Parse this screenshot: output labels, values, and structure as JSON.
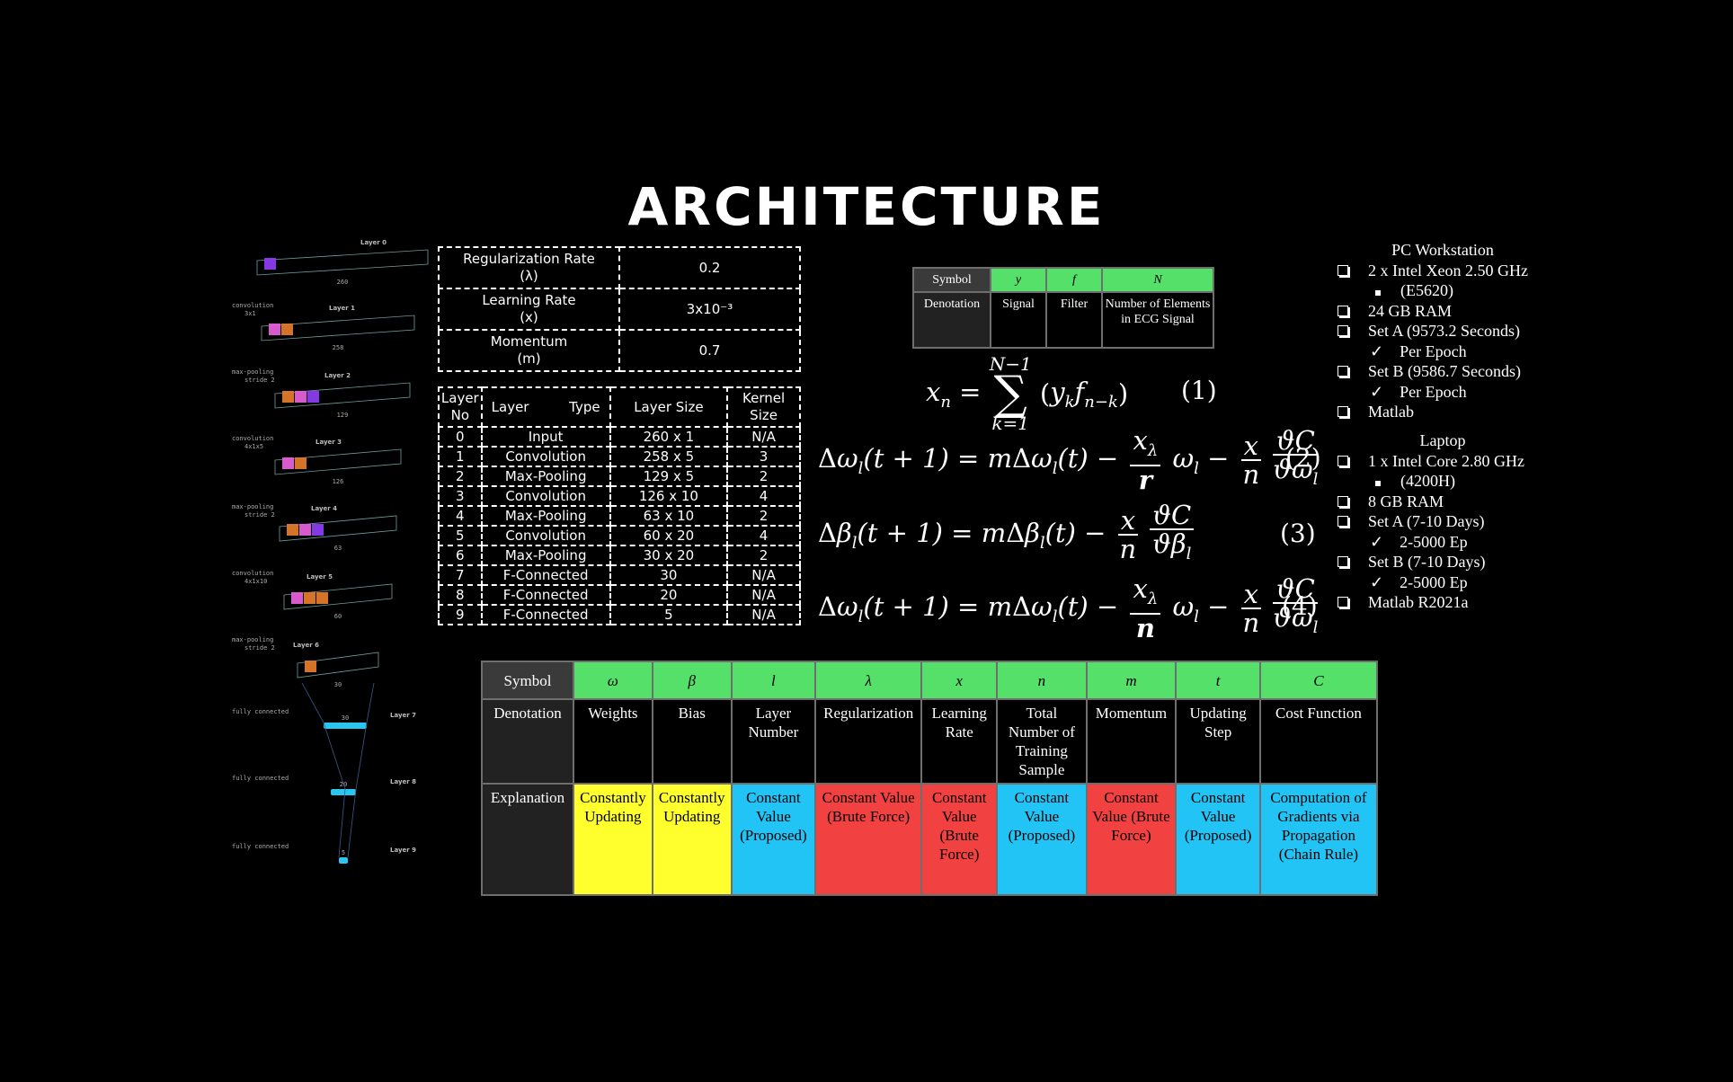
{
  "title": "ARCHITECTURE",
  "hyperparams": [
    {
      "name": "Regularization Rate",
      "symbol": "(λ)",
      "value": "0.2"
    },
    {
      "name": "Learning Rate",
      "symbol": "(x)",
      "value": "3x10⁻³"
    },
    {
      "name": "Momentum",
      "symbol": "(m)",
      "value": "0.7"
    }
  ],
  "layer_table": {
    "headers": {
      "layer_no": "Layer No",
      "layer": "Layer",
      "type": "Type",
      "size": "Layer Size",
      "kernel": "Kernel Size"
    },
    "rows": [
      [
        "0",
        "Input",
        "260 x 1",
        "N/A"
      ],
      [
        "1",
        "Convolution",
        "258 x 5",
        "3"
      ],
      [
        "2",
        "Max-Pooling",
        "129 x 5",
        "2"
      ],
      [
        "3",
        "Convolution",
        "126 x 10",
        "4"
      ],
      [
        "4",
        "Max-Pooling",
        "63 x 10",
        "2"
      ],
      [
        "5",
        "Convolution",
        "60 x 20",
        "4"
      ],
      [
        "6",
        "Max-Pooling",
        "30 x 20",
        "2"
      ],
      [
        "7",
        "F-Connected",
        "30",
        "N/A"
      ],
      [
        "8",
        "F-Connected",
        "20",
        "N/A"
      ],
      [
        "9",
        "F-Connected",
        "5",
        "N/A"
      ]
    ]
  },
  "signal_table": {
    "symbol_label": "Symbol",
    "denotation_label": "Denotation",
    "symbols": [
      "y",
      "f",
      "N"
    ],
    "denotations": [
      "Signal",
      "Filter",
      "Number of Elements in ECG Signal"
    ]
  },
  "equation_numbers": [
    "(1)",
    "(2)",
    "(3)",
    "(4)"
  ],
  "param_table": {
    "symbol_label": "Symbol",
    "denotation_label": "Denotation",
    "explanation_label": "Explanation",
    "symbols": [
      "ω",
      "β",
      "l",
      "λ",
      "x",
      "n",
      "m",
      "t",
      "C"
    ],
    "denotations": [
      "Weights",
      "Bias",
      "Layer Number",
      "Regularization",
      "Learning Rate",
      "Total Number of Training Sample",
      "Momentum",
      "Updating Step",
      "Cost Function"
    ],
    "explanations": [
      "Constantly Updating",
      "Constantly Updating",
      "Constant Value (Proposed)",
      "Constant Value (Brute Force)",
      "Constant Value (Brute Force)",
      "Constant Value (Proposed)",
      "Constant Value (Brute Force)",
      "Constant Value (Proposed)",
      "Computation of Gradients via Propagation (Chain Rule)"
    ],
    "colors": [
      "#ffff2e",
      "#ffff2e",
      "#22c4f5",
      "#f24141",
      "#f24141",
      "#22c4f5",
      "#f24141",
      "#22c4f5",
      "#22c4f5"
    ]
  },
  "pc": {
    "heading": "PC Workstation",
    "items": [
      {
        "kind": "box",
        "text": "2 x Intel Xeon 2.50 GHz"
      },
      {
        "kind": "square",
        "text": "(E5620)"
      },
      {
        "kind": "box",
        "text": "24 GB RAM"
      },
      {
        "kind": "box",
        "text": "Set A (9573.2 Seconds)"
      },
      {
        "kind": "check",
        "text": "Per Epoch"
      },
      {
        "kind": "box",
        "text": "Set B (9586.7 Seconds)"
      },
      {
        "kind": "check",
        "text": "Per Epoch"
      },
      {
        "kind": "box",
        "text": "Matlab"
      }
    ]
  },
  "laptop": {
    "heading": "Laptop",
    "items": [
      {
        "kind": "box",
        "text": "1 x Intel Core 2.80 GHz"
      },
      {
        "kind": "square",
        "text": "(4200H)"
      },
      {
        "kind": "box",
        "text": "8 GB RAM"
      },
      {
        "kind": "box",
        "text": "Set A (7-10 Days)"
      },
      {
        "kind": "check",
        "text": "2-5000 Ep"
      },
      {
        "kind": "box",
        "text": "Set B (7-10 Days)"
      },
      {
        "kind": "check",
        "text": "2-5000 Ep"
      },
      {
        "kind": "box",
        "text": "Matlab R2021a"
      }
    ]
  },
  "diagram": {
    "layers": [
      "Layer 0",
      "Layer 1",
      "Layer 2",
      "Layer 3",
      "Layer 4",
      "Layer 5",
      "Layer 6",
      "Layer 7",
      "Layer 8",
      "Layer 9"
    ],
    "sizes": [
      "260",
      "258",
      "129",
      "126",
      "63",
      "60",
      "30",
      "30",
      "20",
      "5"
    ],
    "ops": [
      [
        "convolution",
        "3x1"
      ],
      [
        "max-pooling",
        "stride 2"
      ],
      [
        "convolution",
        "4x1x5"
      ],
      [
        "max-pooling",
        "stride 2"
      ],
      [
        "convolution",
        "4x1x10"
      ],
      [
        "max-pooling",
        "stride 2"
      ],
      [
        "fully connected",
        ""
      ],
      [
        "fully connected",
        ""
      ],
      [
        "fully connected",
        ""
      ]
    ]
  },
  "icons": {
    "box_bullet": "checkbox-bullet-icon",
    "square_bullet": "square-bullet-icon",
    "check_bullet": "checkmark-icon"
  }
}
